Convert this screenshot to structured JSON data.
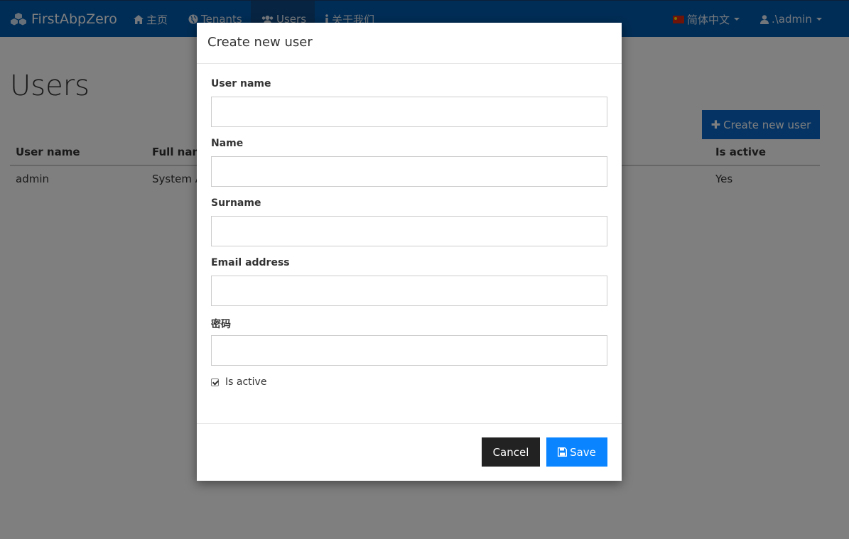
{
  "navbar": {
    "brand": "FirstAbpZero",
    "items": [
      {
        "label": "主页",
        "icon": "home-icon"
      },
      {
        "label": "Tenants",
        "icon": "globe-icon"
      },
      {
        "label": "Users",
        "icon": "users-icon"
      },
      {
        "label": "关于我们",
        "icon": "info-icon"
      }
    ],
    "language": "简体中文",
    "user": ".\\admin"
  },
  "page": {
    "title": "Users",
    "create_button": "Create new user",
    "table": {
      "headers": [
        "User name",
        "Full name",
        "Is active"
      ],
      "rows": [
        {
          "user_name": "admin",
          "full_name": "System A",
          "is_active": "Yes"
        }
      ]
    }
  },
  "modal": {
    "title": "Create new user",
    "fields": [
      {
        "label": "User name",
        "value": ""
      },
      {
        "label": "Name",
        "value": ""
      },
      {
        "label": "Surname",
        "value": ""
      },
      {
        "label": "Email address",
        "value": ""
      },
      {
        "label": "密码",
        "value": ""
      }
    ],
    "is_active_label": "Is active",
    "is_active_checked": true,
    "cancel_label": "Cancel",
    "save_label": "Save"
  },
  "colors": {
    "navbar": "#005aad",
    "primary_button": "#0a68c9",
    "save_button": "#0a84ff",
    "cancel_button": "#222222"
  }
}
